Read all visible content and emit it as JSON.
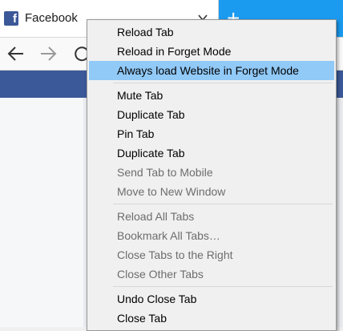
{
  "browser": {
    "tab": {
      "title": "Facebook",
      "favicon_letter": "f",
      "favicon_color": "#3b5998"
    },
    "newtab_symbol": "+",
    "accent_color": "#1a9bf0",
    "page_header_color": "#3b5998"
  },
  "context_menu": {
    "items": [
      {
        "label": "Reload Tab"
      },
      {
        "label": "Reload in Forget Mode"
      },
      {
        "label": "Always load Website in Forget Mode"
      },
      {
        "label": "Mute Tab"
      },
      {
        "label": "Duplicate Tab"
      },
      {
        "label": "Pin Tab"
      },
      {
        "label": "Duplicate Tab"
      },
      {
        "label": "Send Tab to Mobile"
      },
      {
        "label": "Move to New Window"
      },
      {
        "label": "Reload All Tabs"
      },
      {
        "label": "Bookmark All Tabs…"
      },
      {
        "label": "Close Tabs to the Right"
      },
      {
        "label": "Close Other Tabs"
      },
      {
        "label": "Undo Close Tab"
      },
      {
        "label": "Close Tab"
      }
    ],
    "highlighted_index": 2,
    "highlight_color": "#91c9f7"
  }
}
